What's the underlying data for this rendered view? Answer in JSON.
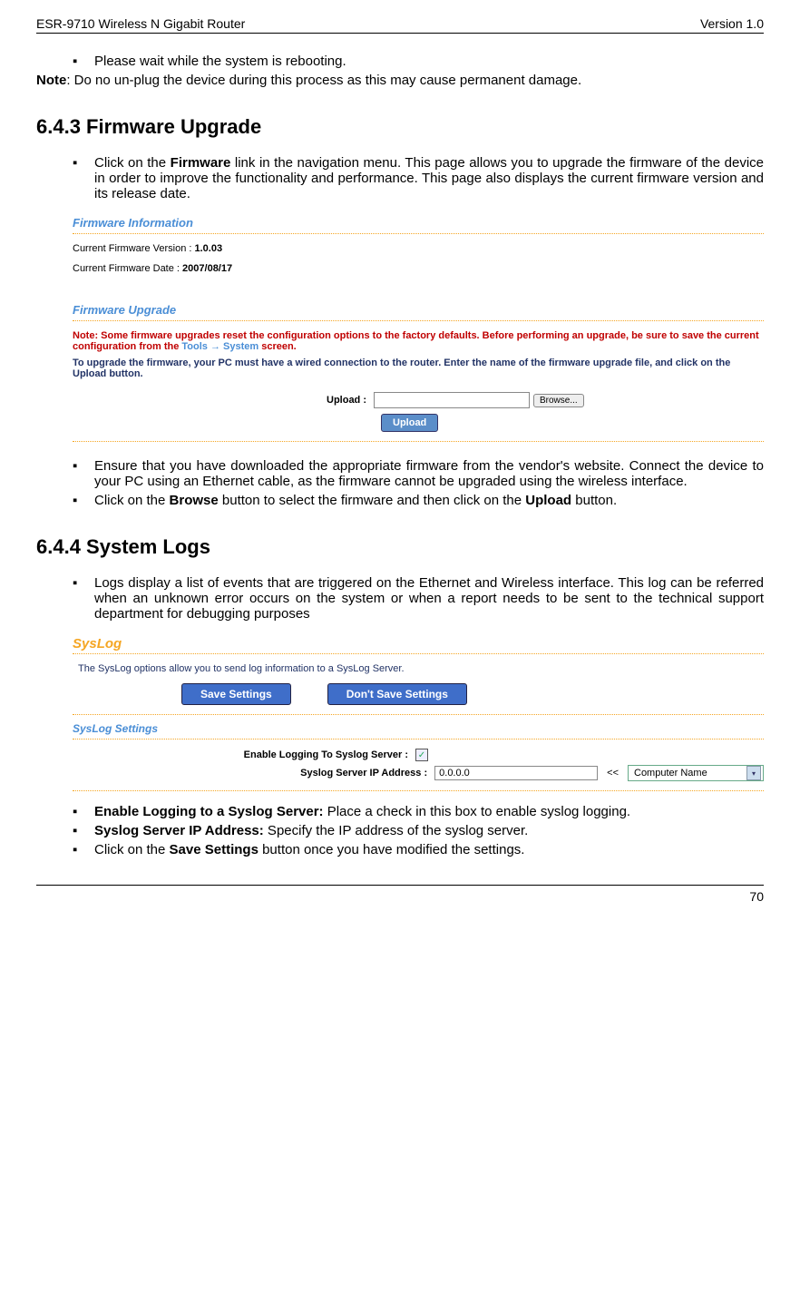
{
  "header": {
    "left": "ESR-9710 Wireless N Gigabit Router",
    "right": "Version 1.0"
  },
  "intro": {
    "bullet": "Please wait while the system is rebooting.",
    "note_label": "Note",
    "note_text": ": Do no un-plug the device during this process as this may cause permanent damage."
  },
  "s643": {
    "heading": "6.4.3 Firmware Upgrade",
    "bullet1_pre": "Click on the ",
    "bullet1_bold": "Firmware",
    "bullet1_post": " link in the navigation menu. This page allows you to upgrade the firmware of the device in order to improve the functionality and performance. This page also displays the current firmware version and its release date.",
    "bullet2": "Ensure that you have downloaded the appropriate firmware from the vendor's website. Connect the device to your PC using an Ethernet cable, as the firmware cannot be upgraded using the wireless interface.",
    "bullet3_pre": "Click on the ",
    "bullet3_b1": "Browse",
    "bullet3_mid": " button to select the firmware and then click on the ",
    "bullet3_b2": "Upload",
    "bullet3_post": " button."
  },
  "fw_panel": {
    "info_title": "Firmware Information",
    "ver_label": "Current Firmware Version :",
    "ver_value": "1.0.03",
    "date_label": "Current Firmware Date :",
    "date_value": "2007/08/17",
    "upgrade_title": "Firmware Upgrade",
    "note_pre": "Note: Some firmware upgrades reset the configuration options to the factory defaults. Before performing an upgrade, be sure to save the current configuration from the ",
    "note_link": "Tools → System",
    "note_post": " screen.",
    "desc": "To upgrade the firmware, your PC must have a wired connection to the router. Enter the name of the firmware upgrade file, and click on the Upload button.",
    "upload_label": "Upload :",
    "browse": "Browse...",
    "upload_btn": "Upload"
  },
  "s644": {
    "heading": "6.4.4 System Logs",
    "bullet1": "Logs display a list of events that are triggered on the Ethernet and Wireless interface. This log can be referred when an unknown error occurs on the system or when a report needs to be sent to the technical support department for debugging purposes",
    "bullet2_b": "Enable Logging to a Syslog Server:",
    "bullet2_t": " Place a check in this box to enable syslog logging.",
    "bullet3_b": "Syslog Server IP Address:",
    "bullet3_t": " Specify the IP address of the syslog server.",
    "bullet4_pre": "Click on the ",
    "bullet4_b": "Save Settings",
    "bullet4_post": " button once you have modified the settings."
  },
  "syslog": {
    "title": "SysLog",
    "desc": "The SysLog options allow you to send log information to a SysLog Server.",
    "save_btn": "Save Settings",
    "dont_btn": "Don't Save Settings",
    "settings_title": "SysLog Settings",
    "enable_label": "Enable Logging To Syslog Server :",
    "enable_check": "✓",
    "ip_label": "Syslog Server IP Address :",
    "ip_value": "0.0.0.0",
    "lshift": "<<",
    "dropdown": "Computer Name"
  },
  "footer": {
    "page": "70"
  }
}
